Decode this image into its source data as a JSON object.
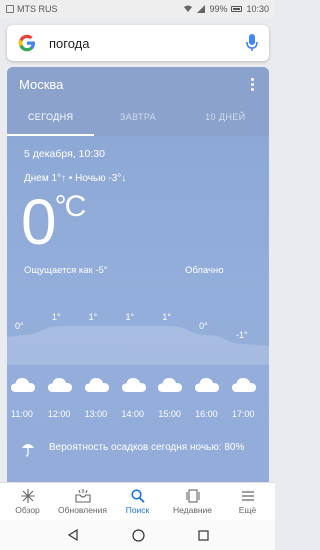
{
  "status_bar": {
    "carrier": "MTS RUS",
    "battery": "99%",
    "time": "10:30"
  },
  "search": {
    "query": "погода"
  },
  "weather": {
    "city": "Москва",
    "tabs": [
      {
        "label": "СЕГОДНЯ",
        "active": true
      },
      {
        "label": "ЗАВТРА",
        "active": false
      },
      {
        "label": "10 ДНЕЙ",
        "active": false
      }
    ],
    "date": "5 декабря, 10:30",
    "day_night": "Днем 1°↑ • Ночью -3°↓",
    "temperature": "0",
    "unit": "°C",
    "feels_like": "Ощущается как -5°",
    "condition": "Облачно",
    "hourly": [
      {
        "time": "11:00",
        "temp": "0°",
        "value": 0,
        "icon": "cloud-icon"
      },
      {
        "time": "12:00",
        "temp": "1°",
        "value": 1,
        "icon": "cloud-icon"
      },
      {
        "time": "13:00",
        "temp": "1°",
        "value": 1,
        "icon": "cloud-icon"
      },
      {
        "time": "14:00",
        "temp": "1°",
        "value": 1,
        "icon": "cloud-icon"
      },
      {
        "time": "15:00",
        "temp": "1°",
        "value": 1,
        "icon": "cloud-icon"
      },
      {
        "time": "16:00",
        "temp": "0°",
        "value": 0,
        "icon": "cloud-icon"
      },
      {
        "time": "17:00",
        "temp": "-1°",
        "value": -1,
        "icon": "cloud-icon"
      }
    ],
    "precipitation": "Вероятность осадков сегодня ночью: 80%",
    "precipitation_icon": "umbrella-icon"
  },
  "bottom_nav": [
    {
      "label": "Обзор",
      "icon": "sparkle-icon",
      "active": false
    },
    {
      "label": "Обновления",
      "icon": "inbox-icon",
      "active": false
    },
    {
      "label": "Поиск",
      "icon": "search-icon",
      "active": true
    },
    {
      "label": "Недавние",
      "icon": "recent-icon",
      "active": false
    },
    {
      "label": "Ещё",
      "icon": "menu-icon",
      "active": false
    }
  ],
  "colors": {
    "card_bg": "#8aa6d3",
    "accent": "#1a73e8"
  }
}
